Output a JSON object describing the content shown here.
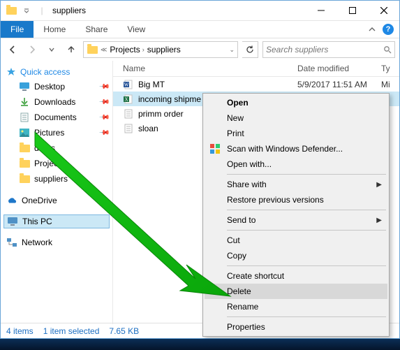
{
  "title": "suppliers",
  "ribbon": {
    "file": "File",
    "tabs": [
      "Home",
      "Share",
      "View"
    ]
  },
  "address": {
    "crumb1": "Projects",
    "crumb2": "suppliers"
  },
  "search_placeholder": "Search suppliers",
  "sidebar": {
    "quick_access": "Quick access",
    "items": [
      {
        "label": "Desktop",
        "icon": "desktop",
        "pin": true
      },
      {
        "label": "Downloads",
        "icon": "downloads",
        "pin": true
      },
      {
        "label": "Documents",
        "icon": "documents",
        "pin": true
      },
      {
        "label": "Pictures",
        "icon": "pictures",
        "pin": true
      },
      {
        "label": "drafts",
        "icon": "folder",
        "pin": false
      },
      {
        "label": "Projects",
        "icon": "folder",
        "pin": false
      },
      {
        "label": "suppliers",
        "icon": "folder",
        "pin": false
      }
    ],
    "onedrive": "OneDrive",
    "thispc": "This PC",
    "network": "Network"
  },
  "columns": {
    "name": "Name",
    "date": "Date modified",
    "type": "Ty"
  },
  "files": [
    {
      "name": "Big MT",
      "icon": "word",
      "date": "5/9/2017 11:51 AM",
      "type": "Mi",
      "selected": false
    },
    {
      "name": "incoming shipme",
      "icon": "excel",
      "date": "",
      "type": "",
      "selected": true
    },
    {
      "name": "primm order",
      "icon": "text",
      "date": "",
      "type": "",
      "selected": false
    },
    {
      "name": "sloan",
      "icon": "text",
      "date": "",
      "type": "",
      "selected": false
    }
  ],
  "status": {
    "count": "4 items",
    "sel": "1 item selected",
    "size": "7.65 KB"
  },
  "context_menu": {
    "open": "Open",
    "new": "New",
    "print": "Print",
    "scan": "Scan with Windows Defender...",
    "openwith": "Open with...",
    "sharewith": "Share with",
    "restore": "Restore previous versions",
    "sendto": "Send to",
    "cut": "Cut",
    "copy": "Copy",
    "shortcut": "Create shortcut",
    "delete": "Delete",
    "rename": "Rename",
    "properties": "Properties"
  }
}
